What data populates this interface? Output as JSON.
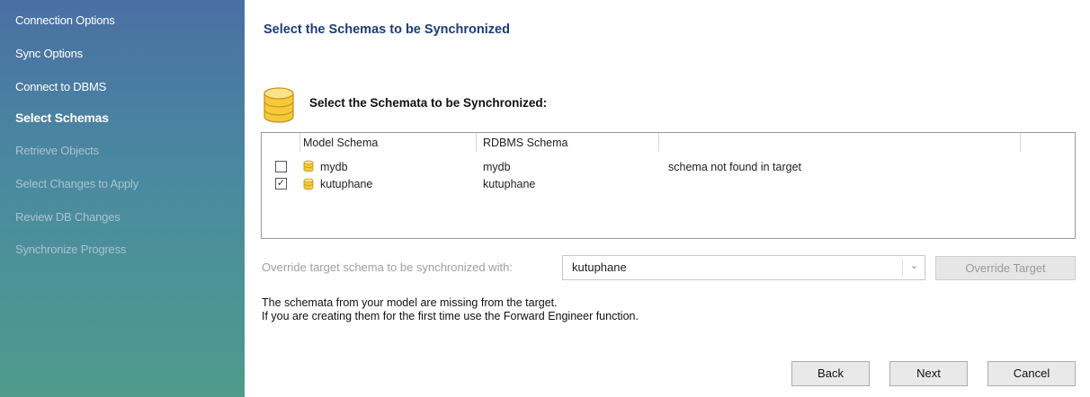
{
  "sidebar": {
    "items": [
      {
        "label": "Connection Options",
        "state": "done"
      },
      {
        "label": "Sync Options",
        "state": "done"
      },
      {
        "label": "Connect to DBMS",
        "state": "done"
      },
      {
        "label": "Select Schemas",
        "state": "active"
      },
      {
        "label": "Retrieve Objects",
        "state": "pending"
      },
      {
        "label": "Select Changes to Apply",
        "state": "pending"
      },
      {
        "label": "Review DB Changes",
        "state": "pending"
      },
      {
        "label": "Synchronize Progress",
        "state": "pending"
      }
    ]
  },
  "main": {
    "title": "Select the Schemas to be Synchronized",
    "section_title": "Select the Schemata to be Synchronized:",
    "table": {
      "columns": [
        "Model Schema",
        "RDBMS Schema",
        ""
      ],
      "rows": [
        {
          "checked": false,
          "model": "mydb",
          "rdbms": "mydb",
          "note": "schema not found in target"
        },
        {
          "checked": true,
          "model": "kutuphane",
          "rdbms": "kutuphane",
          "note": ""
        }
      ]
    },
    "override": {
      "label": "Override target schema to be synchronized with:",
      "value": "kutuphane",
      "button": "Override Target"
    },
    "info_lines": [
      "The schemata from your model are missing from the target.",
      "If you are creating them for the first time use the Forward Engineer function."
    ]
  },
  "buttons": {
    "back": "Back",
    "next": "Next",
    "cancel": "Cancel"
  },
  "icons": {
    "database": "database-icon",
    "checkbox_checked": "☑",
    "check_mark": "✓",
    "dropdown": "chevron-down-icon"
  },
  "colors": {
    "title": "#1d3c78",
    "sidebar_top": "#4a6fa3",
    "sidebar_bottom": "#4f9b8c",
    "db_icon": "#f2c12e"
  }
}
